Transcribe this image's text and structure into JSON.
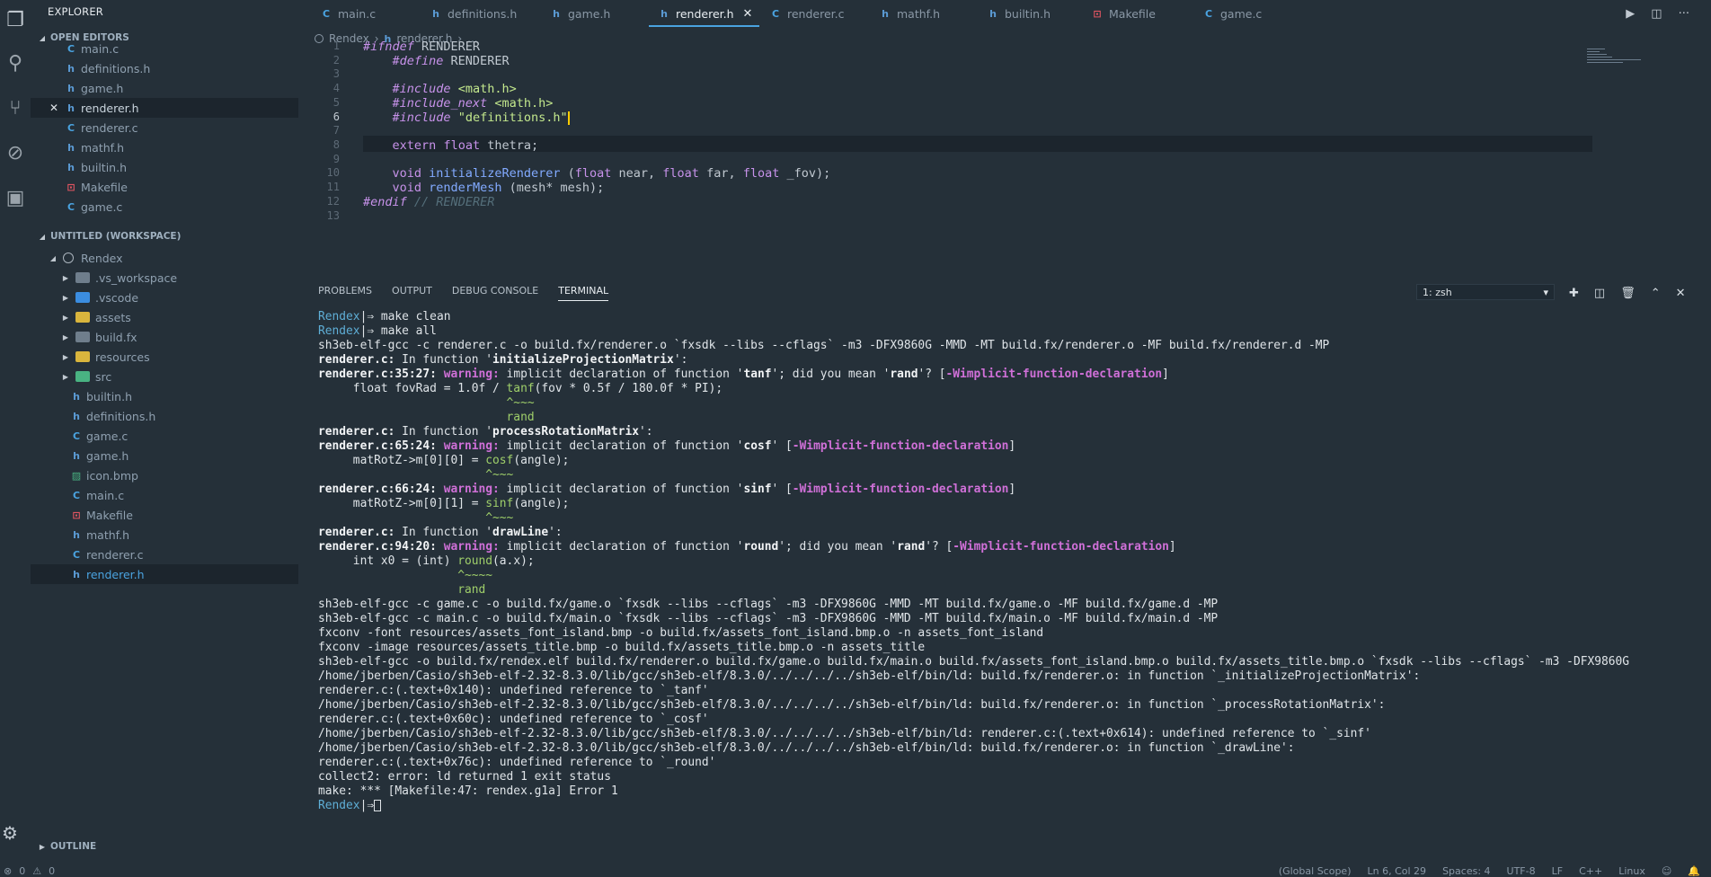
{
  "sidebar": {
    "title": "EXPLORER",
    "open_editors_label": "OPEN EDITORS",
    "open_editors": [
      {
        "type": "C",
        "name": "main.c"
      },
      {
        "type": "h",
        "name": "definitions.h"
      },
      {
        "type": "h",
        "name": "game.h"
      },
      {
        "type": "h",
        "name": "renderer.h",
        "active": true
      },
      {
        "type": "C",
        "name": "renderer.c"
      },
      {
        "type": "h",
        "name": "mathf.h"
      },
      {
        "type": "h",
        "name": "builtin.h"
      },
      {
        "type": "M",
        "name": "Makefile"
      },
      {
        "type": "C",
        "name": "game.c"
      }
    ],
    "workspace_label": "UNTITLED (WORKSPACE)",
    "root_folder": "Rendex",
    "folders": [
      ".vs_workspace",
      ".vscode",
      "assets",
      "build.fx",
      "resources",
      "src"
    ],
    "files": [
      {
        "type": "h",
        "name": "builtin.h"
      },
      {
        "type": "h",
        "name": "definitions.h"
      },
      {
        "type": "C",
        "name": "game.c"
      },
      {
        "type": "h",
        "name": "game.h"
      },
      {
        "type": "B",
        "name": "icon.bmp"
      },
      {
        "type": "C",
        "name": "main.c"
      },
      {
        "type": "M",
        "name": "Makefile"
      },
      {
        "type": "h",
        "name": "mathf.h"
      },
      {
        "type": "C",
        "name": "renderer.c"
      },
      {
        "type": "h",
        "name": "renderer.h",
        "active": true
      }
    ],
    "outline_label": "OUTLINE"
  },
  "tabs": [
    {
      "type": "C",
      "name": "main.c"
    },
    {
      "type": "h",
      "name": "definitions.h"
    },
    {
      "type": "h",
      "name": "game.h"
    },
    {
      "type": "h",
      "name": "renderer.h",
      "active": true
    },
    {
      "type": "C",
      "name": "renderer.c"
    },
    {
      "type": "h",
      "name": "mathf.h"
    },
    {
      "type": "h",
      "name": "builtin.h"
    },
    {
      "type": "M",
      "name": "Makefile"
    },
    {
      "type": "C",
      "name": "game.c"
    }
  ],
  "breadcrumb": {
    "project": "Rendex",
    "file": "renderer.h",
    "more": "..."
  },
  "editor": {
    "line_numbers": [
      "1",
      "2",
      "3",
      "4",
      "5",
      "6",
      "7",
      "8",
      "9",
      "10",
      "11",
      "12",
      "13"
    ],
    "current_line": 6
  },
  "panel": {
    "tabs": [
      "PROBLEMS",
      "OUTPUT",
      "DEBUG CONSOLE",
      "TERMINAL"
    ],
    "active_tab": "TERMINAL",
    "terminal_select": "1: zsh",
    "prompt": "Rendex"
  },
  "terminal_lines": [
    [
      {
        "c": "tprompt",
        "t": "Rendex"
      },
      {
        "t": "|⇒ make clean"
      }
    ],
    [
      {
        "c": "tprompt",
        "t": "Rendex"
      },
      {
        "t": "|⇒ make all"
      }
    ],
    [
      {
        "t": "sh3eb-elf-gcc -c renderer.c -o build.fx/renderer.o `fxsdk --libs --cflags` -m3 -DFX9860G -MMD -MT build.fx/renderer.o -MF build.fx/renderer.d -MP"
      }
    ],
    [
      {
        "c": "tbold",
        "t": "renderer.c:"
      },
      {
        "t": " In function '"
      },
      {
        "c": "tbold",
        "t": "initializeProjectionMatrix"
      },
      {
        "t": "':"
      }
    ],
    [
      {
        "c": "tbold",
        "t": "renderer.c:35:27: "
      },
      {
        "c": "twarn",
        "t": "warning:"
      },
      {
        "t": " implicit declaration of function '"
      },
      {
        "c": "tbold",
        "t": "tanf"
      },
      {
        "t": "'; did you mean '"
      },
      {
        "c": "tbold",
        "t": "rand"
      },
      {
        "t": "'? ["
      },
      {
        "c": "twarn",
        "t": "-Wimplicit-function-declaration"
      },
      {
        "t": "]"
      }
    ],
    [
      {
        "t": "     float fovRad = 1.0f / "
      },
      {
        "c": "tfn",
        "t": "tanf"
      },
      {
        "t": "(fov * 0.5f / 180.0f * PI);"
      }
    ],
    [
      {
        "c": "tcaret",
        "t": "                           ^~~~"
      }
    ],
    [
      {
        "c": "tgreen",
        "t": "                           rand"
      }
    ],
    [
      {
        "c": "tbold",
        "t": "renderer.c:"
      },
      {
        "t": " In function '"
      },
      {
        "c": "tbold",
        "t": "processRotationMatrix"
      },
      {
        "t": "':"
      }
    ],
    [
      {
        "c": "tbold",
        "t": "renderer.c:65:24: "
      },
      {
        "c": "twarn",
        "t": "warning:"
      },
      {
        "t": " implicit declaration of function '"
      },
      {
        "c": "tbold",
        "t": "cosf"
      },
      {
        "t": "' ["
      },
      {
        "c": "twarn",
        "t": "-Wimplicit-function-declaration"
      },
      {
        "t": "]"
      }
    ],
    [
      {
        "t": "     matRotZ->m[0][0] = "
      },
      {
        "c": "tfn",
        "t": "cosf"
      },
      {
        "t": "(angle);"
      }
    ],
    [
      {
        "c": "tcaret",
        "t": "                        ^~~~"
      }
    ],
    [
      {
        "c": "tbold",
        "t": "renderer.c:66:24: "
      },
      {
        "c": "twarn",
        "t": "warning:"
      },
      {
        "t": " implicit declaration of function '"
      },
      {
        "c": "tbold",
        "t": "sinf"
      },
      {
        "t": "' ["
      },
      {
        "c": "twarn",
        "t": "-Wimplicit-function-declaration"
      },
      {
        "t": "]"
      }
    ],
    [
      {
        "t": "     matRotZ->m[0][1] = "
      },
      {
        "c": "tfn",
        "t": "sinf"
      },
      {
        "t": "(angle);"
      }
    ],
    [
      {
        "c": "tcaret",
        "t": "                        ^~~~"
      }
    ],
    [
      {
        "c": "tbold",
        "t": "renderer.c:"
      },
      {
        "t": " In function '"
      },
      {
        "c": "tbold",
        "t": "drawLine"
      },
      {
        "t": "':"
      }
    ],
    [
      {
        "c": "tbold",
        "t": "renderer.c:94:20: "
      },
      {
        "c": "twarn",
        "t": "warning:"
      },
      {
        "t": " implicit declaration of function '"
      },
      {
        "c": "tbold",
        "t": "round"
      },
      {
        "t": "'; did you mean '"
      },
      {
        "c": "tbold",
        "t": "rand"
      },
      {
        "t": "'? ["
      },
      {
        "c": "twarn",
        "t": "-Wimplicit-function-declaration"
      },
      {
        "t": "]"
      }
    ],
    [
      {
        "t": "     int x0 = (int) "
      },
      {
        "c": "tfn",
        "t": "round"
      },
      {
        "t": "(a.x);"
      }
    ],
    [
      {
        "c": "tcaret",
        "t": "                    ^~~~~"
      }
    ],
    [
      {
        "c": "tgreen",
        "t": "                    rand"
      }
    ],
    [
      {
        "t": "sh3eb-elf-gcc -c game.c -o build.fx/game.o `fxsdk --libs --cflags` -m3 -DFX9860G -MMD -MT build.fx/game.o -MF build.fx/game.d -MP"
      }
    ],
    [
      {
        "t": "sh3eb-elf-gcc -c main.c -o build.fx/main.o `fxsdk --libs --cflags` -m3 -DFX9860G -MMD -MT build.fx/main.o -MF build.fx/main.d -MP"
      }
    ],
    [
      {
        "t": "fxconv -font resources/assets_font_island.bmp -o build.fx/assets_font_island.bmp.o -n assets_font_island"
      }
    ],
    [
      {
        "t": "fxconv -image resources/assets_title.bmp -o build.fx/assets_title.bmp.o -n assets_title"
      }
    ],
    [
      {
        "t": "sh3eb-elf-gcc -o build.fx/rendex.elf build.fx/renderer.o build.fx/game.o build.fx/main.o build.fx/assets_font_island.bmp.o build.fx/assets_title.bmp.o `fxsdk --libs --cflags` -m3 -DFX9860G"
      }
    ],
    [
      {
        "t": "/home/jberben/Casio/sh3eb-elf-2.32-8.3.0/lib/gcc/sh3eb-elf/8.3.0/../../../../sh3eb-elf/bin/ld: build.fx/renderer.o: in function `_initializeProjectionMatrix':"
      }
    ],
    [
      {
        "t": "renderer.c:(.text+0x140): undefined reference to `_tanf'"
      }
    ],
    [
      {
        "t": "/home/jberben/Casio/sh3eb-elf-2.32-8.3.0/lib/gcc/sh3eb-elf/8.3.0/../../../../sh3eb-elf/bin/ld: build.fx/renderer.o: in function `_processRotationMatrix':"
      }
    ],
    [
      {
        "t": "renderer.c:(.text+0x60c): undefined reference to `_cosf'"
      }
    ],
    [
      {
        "t": "/home/jberben/Casio/sh3eb-elf-2.32-8.3.0/lib/gcc/sh3eb-elf/8.3.0/../../../../sh3eb-elf/bin/ld: renderer.c:(.text+0x614): undefined reference to `_sinf'"
      }
    ],
    [
      {
        "t": "/home/jberben/Casio/sh3eb-elf-2.32-8.3.0/lib/gcc/sh3eb-elf/8.3.0/../../../../sh3eb-elf/bin/ld: build.fx/renderer.o: in function `_drawLine':"
      }
    ],
    [
      {
        "t": "renderer.c:(.text+0x76c): undefined reference to `_round'"
      }
    ],
    [
      {
        "t": "collect2: error: ld returned 1 exit status"
      }
    ],
    [
      {
        "t": "make: *** [Makefile:47: rendex.g1a] Error 1"
      }
    ],
    [
      {
        "c": "tprompt",
        "t": "Rendex"
      },
      {
        "t": "|⇒"
      },
      {
        "c": "cursor",
        "t": ""
      }
    ]
  ],
  "statusbar": {
    "errors": "0",
    "warnings": "0",
    "scope": "(Global Scope)",
    "position": "Ln 6, Col 29",
    "spaces": "Spaces: 4",
    "encoding": "UTF-8",
    "eol": "LF",
    "language": "C++",
    "os": "Linux"
  }
}
